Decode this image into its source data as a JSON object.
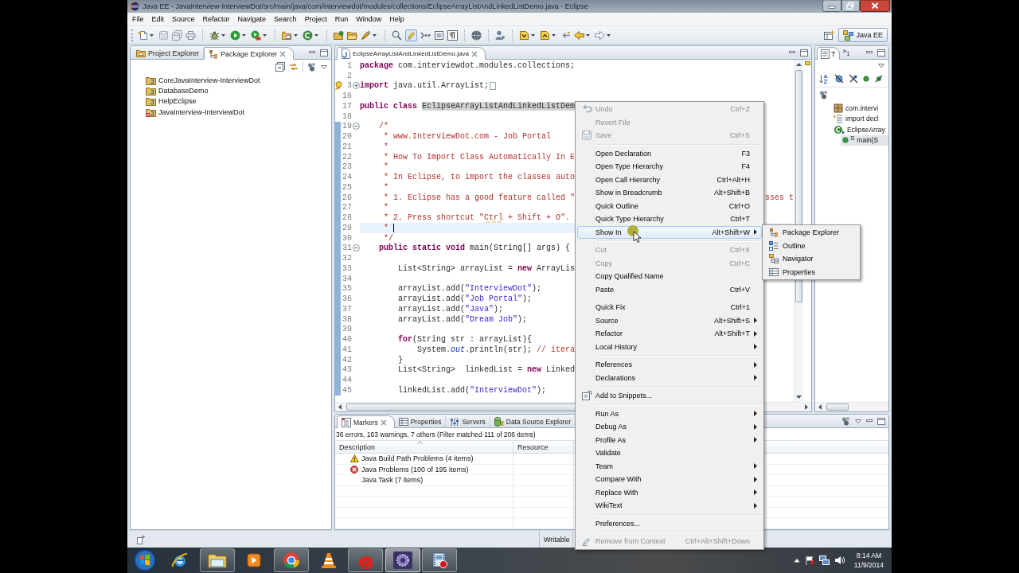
{
  "window": {
    "title": "Java EE - JavaInterview-InterviewDot/src/main/java/com/interviewdot/modules/collections/EclipseArrayListAndLinkedListDemo.java - Eclipse"
  },
  "menu_bar": [
    "File",
    "Edit",
    "Source",
    "Refactor",
    "Navigate",
    "Search",
    "Project",
    "Run",
    "Window",
    "Help"
  ],
  "toolbar": {
    "highlighter_toggle": {
      "on": true
    },
    "perspective": {
      "label": "Java EE",
      "selected": true
    }
  },
  "package_explorer": {
    "tabs": [
      {
        "label": "Project Explorer",
        "selected": false
      },
      {
        "label": "Package Explorer",
        "selected": true
      }
    ],
    "projects": [
      {
        "name": "CoreJavaInterview-InterviewDot",
        "error": false
      },
      {
        "name": "DatabaseDemo",
        "error": false
      },
      {
        "name": "HelpEclipse",
        "error": false
      },
      {
        "name": "JavaInterview-InterviewDot",
        "error": true
      }
    ]
  },
  "editor": {
    "tab": {
      "label": "EclipseArrayListAndLinkedListDemo.java",
      "selected": true
    },
    "lines": [
      {
        "number": "1",
        "changed": false,
        "current": false,
        "warning": false,
        "segments": [
          {
            "kind": "keyword",
            "text": "package"
          },
          {
            "kind": "plain",
            "text": " com.interviewdot.modules.collections;"
          }
        ]
      },
      {
        "number": "2",
        "changed": false,
        "current": false,
        "warning": false
      },
      {
        "number": "3",
        "changed": false,
        "current": false,
        "warning": true,
        "collapsed": true,
        "segments": [
          {
            "kind": "keyword",
            "text": "import"
          },
          {
            "kind": "plain",
            "text": " java.util.ArrayList;"
          }
        ]
      },
      {
        "number": "16",
        "changed": false,
        "current": false,
        "warning": false
      },
      {
        "number": "17",
        "changed": false,
        "current": false,
        "warning": false,
        "segments": [
          {
            "kind": "keyword",
            "text": "public class "
          },
          {
            "kind": "occurrence",
            "text": "EclipseArrayListAndLinkedListDem"
          }
        ]
      },
      {
        "number": "18",
        "changed": false,
        "current": false,
        "warning": false
      },
      {
        "number": "19",
        "changed": true,
        "current": false,
        "warning": false,
        "collapsed": false,
        "segments": [
          {
            "kind": "comment",
            "text": "    /*"
          }
        ]
      },
      {
        "number": "20",
        "changed": true,
        "current": false,
        "warning": false,
        "segments": [
          {
            "kind": "comment",
            "text": "     * www.InterviewDot.com - Job Portal"
          }
        ]
      },
      {
        "number": "21",
        "changed": true,
        "current": false,
        "warning": false,
        "segments": [
          {
            "kind": "comment",
            "text": "     *"
          }
        ]
      },
      {
        "number": "22",
        "changed": true,
        "current": false,
        "warning": false,
        "segments": [
          {
            "kind": "comment",
            "text": "     * How To Import Class Automatically In E"
          }
        ]
      },
      {
        "number": "23",
        "changed": true,
        "current": false,
        "warning": false,
        "segments": [
          {
            "kind": "comment",
            "text": "     *"
          }
        ]
      },
      {
        "number": "24",
        "changed": true,
        "current": false,
        "warning": false,
        "segments": [
          {
            "kind": "comment",
            "text": "     * In Eclipse, to import the classes auto"
          }
        ]
      },
      {
        "number": "25",
        "changed": true,
        "current": false,
        "warning": false,
        "segments": [
          {
            "kind": "comment",
            "text": "     *"
          }
        ]
      },
      {
        "number": "26",
        "changed": true,
        "current": false,
        "warning": false,
        "segments": [
          {
            "kind": "comment",
            "text": "     * 1. Eclipse has a good feature called \""
          }
        ],
        "tail": {
          "kind": "comment",
          "text": "sses t"
        }
      },
      {
        "number": "27",
        "changed": true,
        "current": false,
        "warning": false,
        "segments": [
          {
            "kind": "comment",
            "text": "     *"
          }
        ]
      },
      {
        "number": "28",
        "changed": true,
        "current": false,
        "warning": false,
        "segments": [
          {
            "kind": "comment",
            "text": "     * 2. Press shortcut \""
          },
          {
            "kind": "spelling",
            "text": "Ctrl"
          },
          {
            "kind": "comment",
            "text": " + Shift + O\"."
          }
        ]
      },
      {
        "number": "29",
        "changed": true,
        "current": true,
        "warning": false,
        "segments": [
          {
            "kind": "comment",
            "text": "     * "
          }
        ]
      },
      {
        "number": "30",
        "changed": true,
        "current": false,
        "warning": false,
        "segments": [
          {
            "kind": "comment",
            "text": "     */"
          }
        ]
      },
      {
        "number": "31",
        "changed": true,
        "current": false,
        "warning": false,
        "collapsed": false,
        "segments": [
          {
            "kind": "keyword",
            "text": "    public static void"
          },
          {
            "kind": "plain",
            "text": " main(String[] args) {"
          }
        ]
      },
      {
        "number": "32",
        "changed": true,
        "current": false,
        "warning": false
      },
      {
        "number": "33",
        "changed": true,
        "current": false,
        "warning": false,
        "segments": [
          {
            "kind": "plain",
            "text": "        List<String> arrayList = "
          },
          {
            "kind": "keyword",
            "text": "new"
          },
          {
            "kind": "plain",
            "text": " ArrayLis"
          }
        ]
      },
      {
        "number": "34",
        "changed": true,
        "current": false,
        "warning": false
      },
      {
        "number": "35",
        "changed": true,
        "current": false,
        "warning": false,
        "segments": [
          {
            "kind": "plain",
            "text": "        arrayList.add("
          },
          {
            "kind": "string",
            "text": "\"InterviewDot\""
          },
          {
            "kind": "plain",
            "text": ");"
          }
        ]
      },
      {
        "number": "36",
        "changed": true,
        "current": false,
        "warning": false,
        "segments": [
          {
            "kind": "plain",
            "text": "        arrayList.add("
          },
          {
            "kind": "string",
            "text": "\"Job Portal\""
          },
          {
            "kind": "plain",
            "text": ");"
          }
        ]
      },
      {
        "number": "37",
        "changed": true,
        "current": false,
        "warning": false,
        "segments": [
          {
            "kind": "plain",
            "text": "        arrayList.add("
          },
          {
            "kind": "string",
            "text": "\"Java\""
          },
          {
            "kind": "plain",
            "text": ");"
          }
        ]
      },
      {
        "number": "38",
        "changed": true,
        "current": false,
        "warning": false,
        "segments": [
          {
            "kind": "plain",
            "text": "        arrayList.add("
          },
          {
            "kind": "string",
            "text": "\"Dream Job\""
          },
          {
            "kind": "plain",
            "text": ");"
          }
        ]
      },
      {
        "number": "39",
        "changed": true,
        "current": false,
        "warning": false
      },
      {
        "number": "40",
        "changed": true,
        "current": false,
        "warning": false,
        "segments": [
          {
            "kind": "keyword",
            "text": "        for"
          },
          {
            "kind": "plain",
            "text": "(String str : arrayList){"
          }
        ]
      },
      {
        "number": "41",
        "changed": true,
        "current": false,
        "warning": false,
        "segments": [
          {
            "kind": "plain",
            "text": "            System."
          },
          {
            "kind": "field",
            "text": "out"
          },
          {
            "kind": "plain",
            "text": ".println(str); "
          },
          {
            "kind": "line_comment",
            "text": "// itera"
          }
        ]
      },
      {
        "number": "42",
        "changed": true,
        "current": false,
        "warning": false,
        "segments": [
          {
            "kind": "plain",
            "text": "        }"
          }
        ]
      },
      {
        "number": "43",
        "changed": true,
        "current": false,
        "warning": false,
        "segments": [
          {
            "kind": "plain",
            "text": "        List<String>  linkedList = "
          },
          {
            "kind": "keyword",
            "text": "new"
          },
          {
            "kind": "plain",
            "text": " Linked"
          }
        ]
      },
      {
        "number": "44",
        "changed": true,
        "current": false,
        "warning": false
      },
      {
        "number": "45",
        "changed": true,
        "current": false,
        "warning": false,
        "segments": [
          {
            "kind": "plain",
            "text": "        linkedList.add("
          },
          {
            "kind": "string",
            "text": "\"InterviewDot\""
          },
          {
            "kind": "plain",
            "text": ");"
          }
        ]
      }
    ]
  },
  "outline": {
    "tabs": [
      {
        "label": "T",
        "selected": true
      }
    ],
    "overflow": {
      "chevron": "»",
      "count": "1"
    },
    "items": [
      {
        "kind": "package",
        "label": "com.intervi",
        "selected": false
      },
      {
        "kind": "imports",
        "label": "import decl",
        "selected": false
      },
      {
        "kind": "class",
        "label": "EclipseArray",
        "selected": false,
        "children": [
          {
            "kind": "method",
            "badge": "S",
            "label": "main(S",
            "selected": true
          }
        ]
      }
    ]
  },
  "markers": {
    "tabs": [
      {
        "kind": "markers",
        "label": "Markers",
        "selected": true
      },
      {
        "kind": "properties",
        "label": "Properties",
        "selected": false
      },
      {
        "kind": "servers",
        "label": "Servers",
        "selected": false
      },
      {
        "kind": "data_source",
        "label": "Data Source Explorer",
        "selected": false
      }
    ],
    "summary": "36 errors, 163 warnings, 7 others (Filter matched 111 of 206 items)",
    "columns": [
      "Description",
      "Resource"
    ],
    "rows": [
      {
        "kind": "warning",
        "description": "Java Build Path Problems (4 items)"
      },
      {
        "kind": "error",
        "description": "Java Problems (100 of 195 items)"
      },
      {
        "kind": "task",
        "description": "Java Task (7 items)"
      }
    ]
  },
  "status_bar": {
    "mode": "Writable"
  },
  "context_menu": {
    "groups": [
      [
        {
          "kind": "undo",
          "label": "Undo",
          "shortcut": "Ctrl+Z",
          "disabled": true,
          "submenu": false,
          "selected": false
        },
        {
          "kind": "command",
          "label": "Revert File",
          "disabled": true,
          "submenu": false,
          "selected": false
        },
        {
          "kind": "save",
          "label": "Save",
          "shortcut": "Ctrl+S",
          "disabled": true,
          "submenu": false,
          "selected": false
        }
      ],
      [
        {
          "kind": "command",
          "label": "Open Declaration",
          "shortcut": "F3",
          "disabled": false,
          "submenu": false,
          "selected": false
        },
        {
          "kind": "command",
          "label": "Open Type Hierarchy",
          "shortcut": "F4",
          "disabled": false,
          "submenu": false,
          "selected": false
        },
        {
          "kind": "command",
          "label": "Open Call Hierarchy",
          "shortcut": "Ctrl+Alt+H",
          "disabled": false,
          "submenu": false,
          "selected": false
        },
        {
          "kind": "command",
          "label": "Show in Breadcrumb",
          "shortcut": "Alt+Shift+B",
          "disabled": false,
          "submenu": false,
          "selected": false
        },
        {
          "kind": "command",
          "label": "Quick Outline",
          "shortcut": "Ctrl+O",
          "disabled": false,
          "submenu": false,
          "selected": false
        },
        {
          "kind": "command",
          "label": "Quick Type Hierarchy",
          "shortcut": "Ctrl+T",
          "disabled": false,
          "submenu": false,
          "selected": false
        },
        {
          "kind": "command",
          "label": "Show In",
          "shortcut": "Alt+Shift+W",
          "disabled": false,
          "submenu": true,
          "selected": true
        }
      ],
      [
        {
          "kind": "command",
          "label": "Cut",
          "shortcut": "Ctrl+X",
          "disabled": true,
          "submenu": false,
          "selected": false
        },
        {
          "kind": "command",
          "label": "Copy",
          "shortcut": "Ctrl+C",
          "disabled": true,
          "submenu": false,
          "selected": false
        },
        {
          "kind": "command",
          "label": "Copy Qualified Name",
          "disabled": false,
          "submenu": false,
          "selected": false
        },
        {
          "kind": "command",
          "label": "Paste",
          "shortcut": "Ctrl+V",
          "disabled": false,
          "submenu": false,
          "selected": false
        }
      ],
      [
        {
          "kind": "command",
          "label": "Quick Fix",
          "shortcut": "Ctrl+1",
          "disabled": false,
          "submenu": false,
          "selected": false
        },
        {
          "kind": "command",
          "label": "Source",
          "shortcut": "Alt+Shift+S",
          "disabled": false,
          "submenu": true,
          "selected": false
        },
        {
          "kind": "command",
          "label": "Refactor",
          "shortcut": "Alt+Shift+T",
          "disabled": false,
          "submenu": true,
          "selected": false
        },
        {
          "kind": "command",
          "label": "Local History",
          "disabled": false,
          "submenu": true,
          "selected": false
        }
      ],
      [
        {
          "kind": "command",
          "label": "References",
          "disabled": false,
          "submenu": true,
          "selected": false
        },
        {
          "kind": "command",
          "label": "Declarations",
          "disabled": false,
          "submenu": true,
          "selected": false
        }
      ],
      [
        {
          "kind": "snippets",
          "label": "Add to Snippets...",
          "disabled": false,
          "submenu": false,
          "selected": false
        }
      ],
      [
        {
          "kind": "command",
          "label": "Run As",
          "disabled": false,
          "submenu": true,
          "selected": false
        },
        {
          "kind": "command",
          "label": "Debug As",
          "disabled": false,
          "submenu": true,
          "selected": false
        },
        {
          "kind": "command",
          "label": "Profile As",
          "disabled": false,
          "submenu": true,
          "selected": false
        },
        {
          "kind": "command",
          "label": "Validate",
          "disabled": false,
          "submenu": false,
          "selected": false
        },
        {
          "kind": "command",
          "label": "Team",
          "disabled": false,
          "submenu": true,
          "selected": false
        },
        {
          "kind": "command",
          "label": "Compare With",
          "disabled": false,
          "submenu": true,
          "selected": false
        },
        {
          "kind": "command",
          "label": "Replace With",
          "disabled": false,
          "submenu": true,
          "selected": false
        },
        {
          "kind": "command",
          "label": "WikiText",
          "disabled": false,
          "submenu": true,
          "selected": false
        }
      ],
      [
        {
          "kind": "command",
          "label": "Preferences...",
          "disabled": false,
          "submenu": false,
          "selected": false
        }
      ],
      [
        {
          "kind": "context",
          "label": "Remove from Context",
          "shortcut": "Ctrl+Alt+Shift+Down",
          "disabled": true,
          "submenu": false,
          "selected": false
        }
      ]
    ]
  },
  "submenu": {
    "items": [
      {
        "kind": "package_explorer",
        "label": "Package Explorer",
        "selected": false
      },
      {
        "kind": "outline",
        "label": "Outline",
        "selected": false
      },
      {
        "kind": "navigator",
        "label": "Navigator",
        "selected": false
      },
      {
        "kind": "properties",
        "label": "Properties",
        "selected": false
      }
    ]
  },
  "taskbar": {
    "apps": [
      {
        "kind": "browser",
        "running": false,
        "selected": false
      },
      {
        "kind": "folder",
        "running": true,
        "selected": false
      },
      {
        "kind": "media",
        "running": false,
        "selected": false
      },
      {
        "kind": "ball",
        "running": true,
        "selected": false
      },
      {
        "kind": "cone",
        "running": false,
        "selected": false
      },
      {
        "kind": "swirl",
        "running": true,
        "selected": false
      },
      {
        "kind": "gear",
        "running": true,
        "selected": true
      },
      {
        "kind": "film",
        "running": true,
        "selected": false
      }
    ],
    "clock": {
      "time": "8:14 AM",
      "date": "11/9/2014"
    }
  }
}
